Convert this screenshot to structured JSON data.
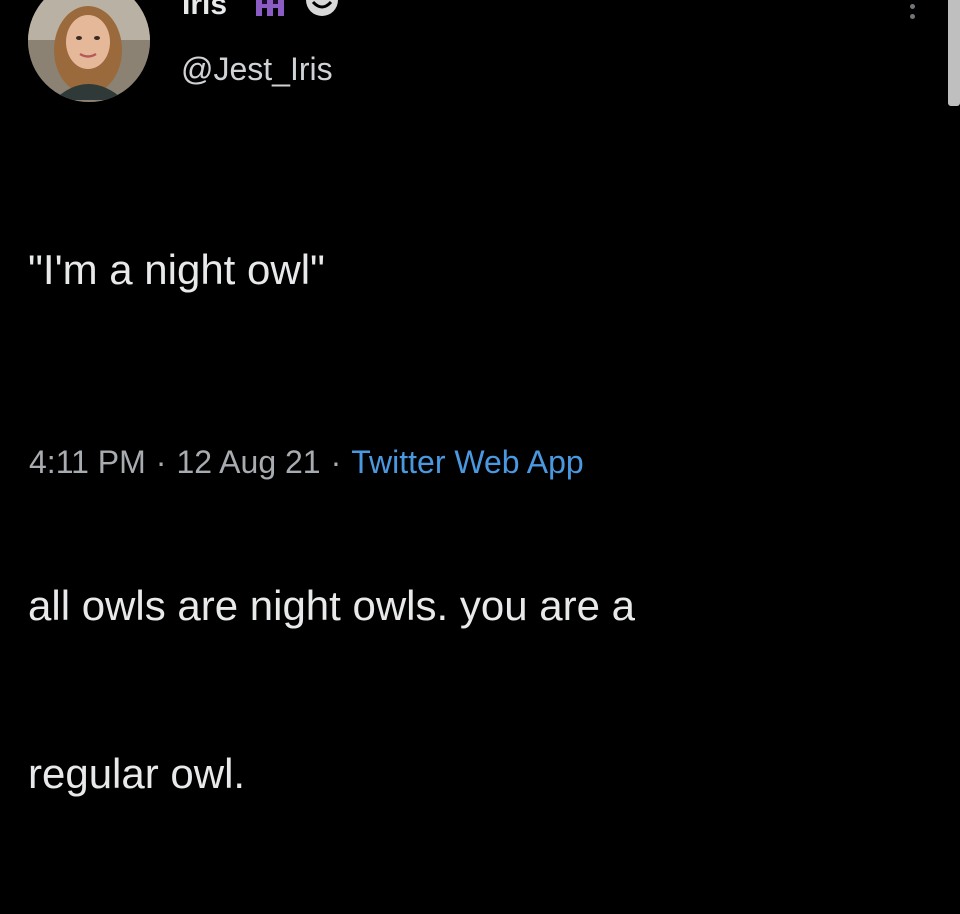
{
  "tweet": {
    "display_name": "Iris",
    "handle": "@Jest_Iris",
    "emojis": [
      "alien-monster-icon",
      "face-icon"
    ],
    "text_line1": "\"I'm a night owl\"",
    "text_line2": "all owls are night owls. you are a",
    "text_line3": "regular owl.",
    "time": "4:11 PM",
    "date": "12 Aug 21",
    "separator": "·",
    "source": "Twitter Web App"
  },
  "colors": {
    "background": "#000000",
    "text": "#e7e9ea",
    "muted": "#a8acb0",
    "link": "#4a98e0",
    "emoji_purple": "#8a5cc4"
  }
}
